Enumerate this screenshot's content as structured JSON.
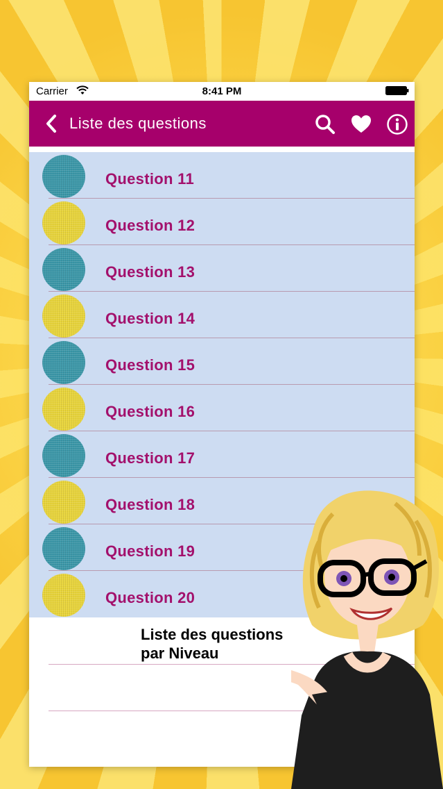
{
  "status": {
    "carrier": "Carrier",
    "time": "8:41 PM"
  },
  "nav": {
    "title": "Liste des questions",
    "actions": [
      "search-icon",
      "heart-icon",
      "info-icon"
    ]
  },
  "questions": [
    {
      "label": "Question 11",
      "color": "#3b97a8"
    },
    {
      "label": "Question 12",
      "color": "#e8d43a"
    },
    {
      "label": "Question 13",
      "color": "#3b97a8"
    },
    {
      "label": "Question 14",
      "color": "#e8d43a"
    },
    {
      "label": "Question 15",
      "color": "#3b97a8"
    },
    {
      "label": "Question 16",
      "color": "#e8d43a"
    },
    {
      "label": "Question 17",
      "color": "#3b97a8"
    },
    {
      "label": "Question 18",
      "color": "#e8d43a"
    },
    {
      "label": "Question 19",
      "color": "#3b97a8"
    },
    {
      "label": "Question 20",
      "color": "#e8d43a"
    }
  ],
  "caption": {
    "line1": "Liste des questions",
    "line2": "par  Niveau"
  },
  "colors": {
    "accent": "#a6006b",
    "list_bg": "#cddcf2",
    "label": "#a3106c"
  }
}
